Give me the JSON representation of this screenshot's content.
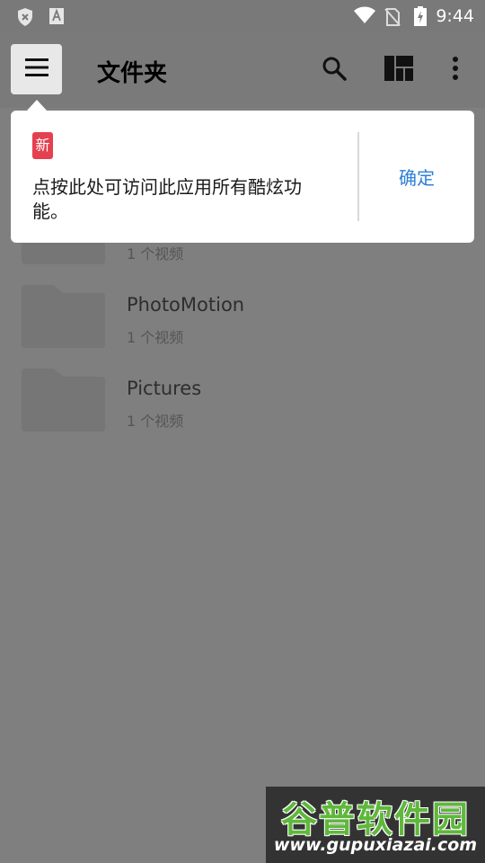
{
  "status_bar": {
    "time": "9:44",
    "icons": [
      "shield-x-icon",
      "font-a-icon",
      "wifi-icon",
      "no-sim-icon",
      "battery-charging-icon"
    ]
  },
  "app_bar": {
    "title": "文件夹",
    "menu_icon": "menu-icon",
    "search_icon": "search-icon",
    "layout_icon": "grid-layout-icon",
    "more_icon": "more-vert-icon"
  },
  "tooltip": {
    "badge": "新",
    "text": "点按此处可访问此应用所有酷炫功能。",
    "ok_label": "确定"
  },
  "folders": [
    {
      "name": "",
      "count": "1 个视频"
    },
    {
      "name": "PhotoMotion",
      "count": "1 个视频"
    },
    {
      "name": "Pictures",
      "count": "1 个视频"
    }
  ],
  "watermark": {
    "title": "谷普软件园",
    "url": "www.gupuxiazai.com"
  },
  "colors": {
    "accent": "#2c7fd6",
    "badge": "#e5404f",
    "scrim": "#7f7f7f"
  }
}
